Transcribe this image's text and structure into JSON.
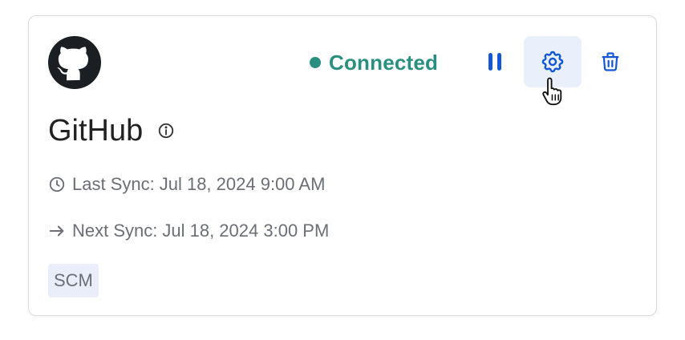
{
  "integration": {
    "name": "GitHub",
    "logo_icon": "github-logo-icon",
    "status": {
      "label": "Connected",
      "color": "#2a8f80"
    },
    "actions": {
      "pause_icon": "pause-icon",
      "settings_icon": "gear-icon",
      "delete_icon": "trash-icon",
      "accent_color": "#1457d6"
    },
    "last_sync": {
      "label": "Last Sync:",
      "value": "Jul 18, 2024 9:00 AM",
      "icon": "clock-icon"
    },
    "next_sync": {
      "label": "Next Sync:",
      "value": "Jul 18, 2024 3:00 PM",
      "icon": "arrow-right-icon"
    },
    "tag": "SCM"
  }
}
